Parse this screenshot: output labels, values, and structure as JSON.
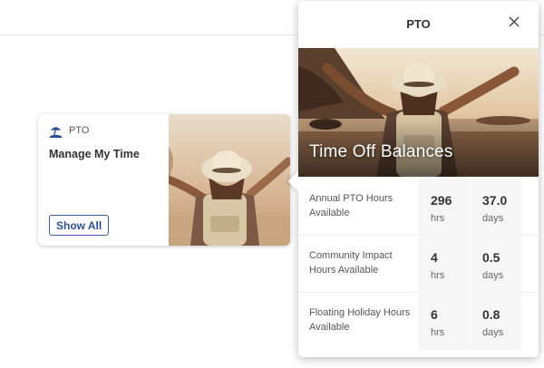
{
  "tile": {
    "category": "PTO",
    "title": "Manage My Time",
    "button_label": "Show All"
  },
  "popover": {
    "title": "PTO",
    "hero_title": "Time Off Balances",
    "balances": [
      {
        "label": "Annual PTO Hours Available",
        "hours": "296",
        "hours_unit": "hrs",
        "days": "37.0",
        "days_unit": "days"
      },
      {
        "label": "Community Impact Hours Available",
        "hours": "4",
        "hours_unit": "hrs",
        "days": "0.5",
        "days_unit": "days"
      },
      {
        "label": "Floating Holiday Hours Available",
        "hours": "6",
        "hours_unit": "hrs",
        "days": "0.8",
        "days_unit": "days"
      }
    ]
  },
  "icons": {
    "tile": "beach-umbrella-icon",
    "close": "close-icon"
  },
  "colors": {
    "accent": "#2d4f93",
    "cell_bg": "#f6f6f6"
  }
}
